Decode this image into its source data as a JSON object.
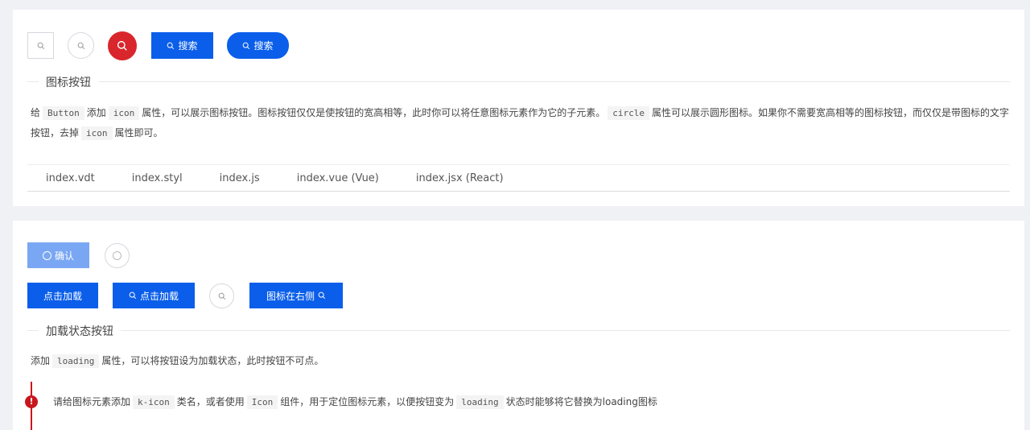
{
  "section1": {
    "buttons": {
      "search_label": "搜索",
      "search_pill_label": "搜索"
    },
    "legend": "图标按钮",
    "desc": [
      "给",
      "Button",
      "添加",
      "icon",
      "属性，可以展示图标按钮。图标按钮仅仅是使按钮的宽高相等，此时你可以将任意图标元素作为它的子元素。",
      "circle",
      "属性可以展示圆形图标。如果你不需要宽高相等的图标按钮，而仅仅是带图标的文字按钮，去掉",
      "icon",
      "属性即可。"
    ],
    "tabs": [
      "index.vdt",
      "index.styl",
      "index.js",
      "index.vue (Vue)",
      "index.jsx (React)"
    ]
  },
  "section2": {
    "confirm_label": "确认",
    "load_label": "点击加载",
    "load_icon_label": "点击加载",
    "icon_right_label": "图标在右侧",
    "legend": "加载状态按钮",
    "desc": [
      "添加",
      "loading",
      "属性，可以将按钮设为加载状态，此时按钮不可点。"
    ],
    "tip": [
      "请给图标元素添加",
      "k-icon",
      "类名，或者使用",
      "Icon",
      "组件，用于定位图标元素，以便按钮变为",
      "loading",
      "状态时能够将它替换为loading图标"
    ]
  },
  "colors": {
    "primary": "#0a5eea",
    "danger": "#d9262c",
    "loading": "#7aa7f3"
  }
}
